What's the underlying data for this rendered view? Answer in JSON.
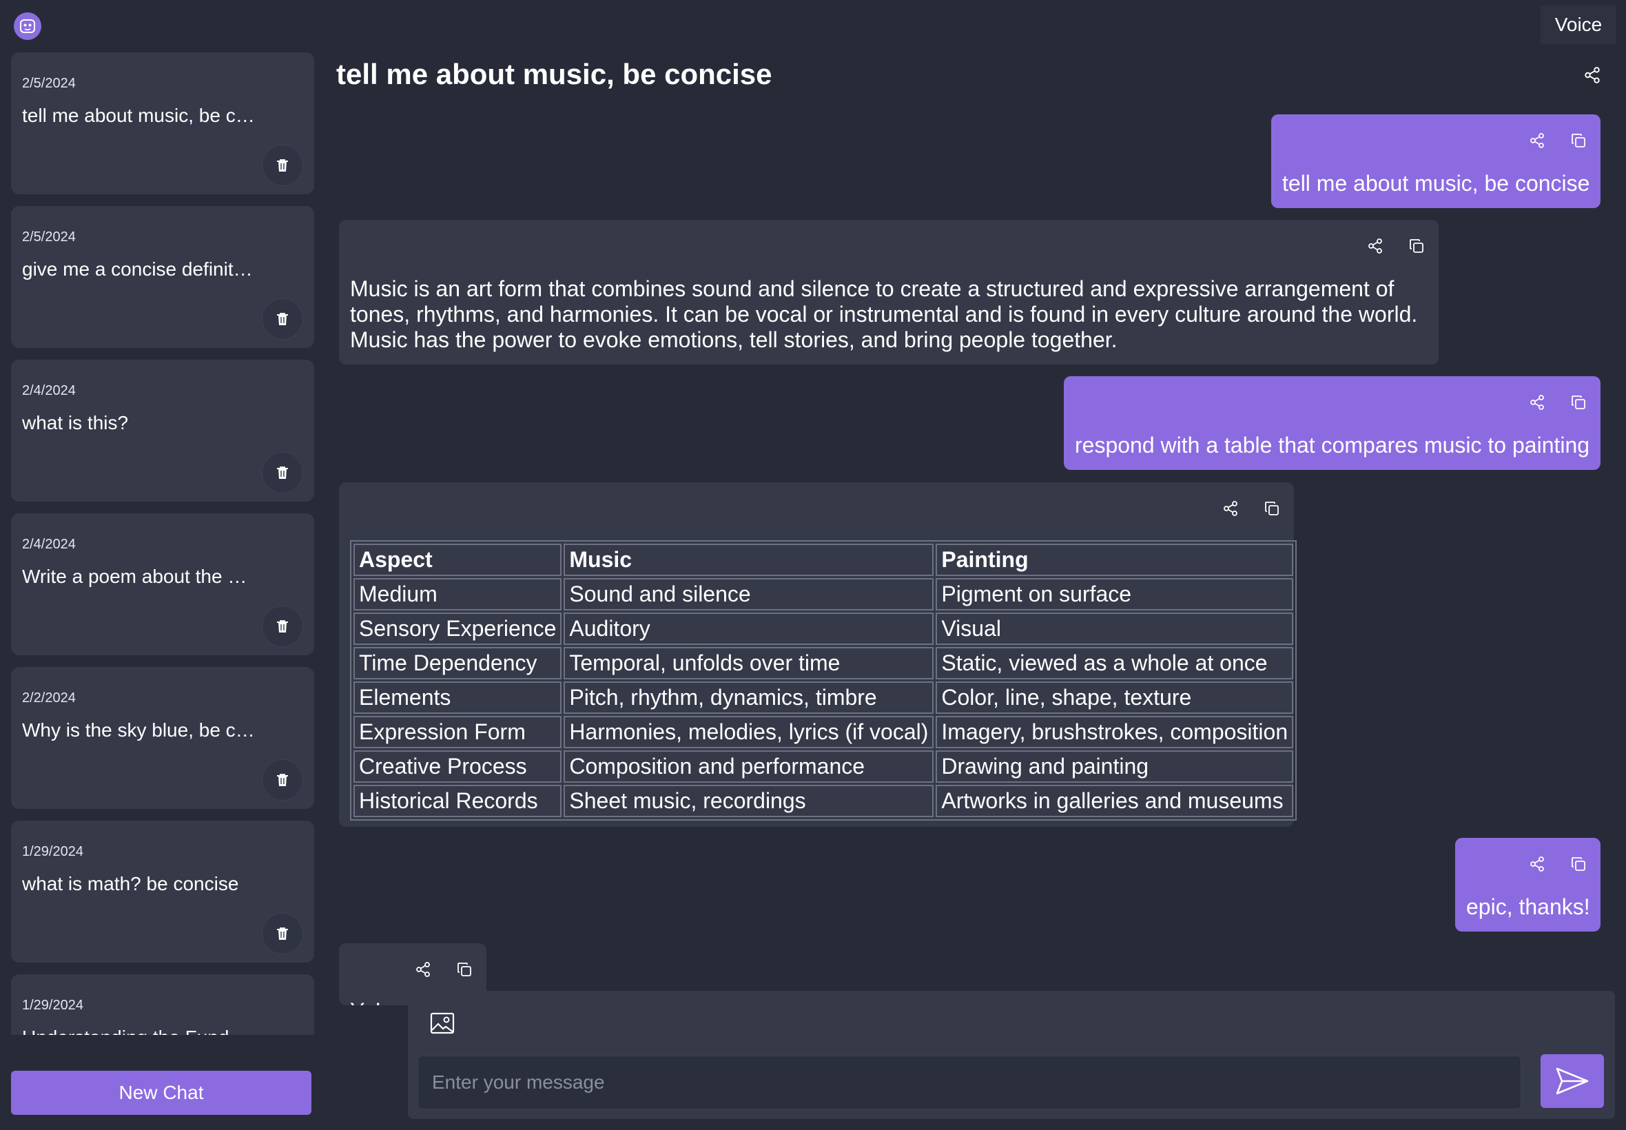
{
  "header": {
    "title": "tell me about music, be concise",
    "voice_label": "Voice"
  },
  "sidebar": {
    "chats": [
      {
        "date": "2/5/2024",
        "title": "tell me about music, be concise"
      },
      {
        "date": "2/5/2024",
        "title": "give me a concise definition"
      },
      {
        "date": "2/4/2024",
        "title": "what is this?"
      },
      {
        "date": "2/4/2024",
        "title": "Write a poem about the sea"
      },
      {
        "date": "2/2/2024",
        "title": "Why is the sky blue, be concise"
      },
      {
        "date": "1/29/2024",
        "title": "what is math? be concise"
      },
      {
        "date": "1/29/2024",
        "title": "Understanding the Fund"
      }
    ],
    "new_chat_label": "New Chat"
  },
  "conversation": {
    "messages": [
      {
        "role": "user",
        "text": "tell me about music, be concise"
      },
      {
        "role": "assistant",
        "text": "Music is an art form that combines sound and silence to create a structured and expressive arrangement of tones, rhythms, and harmonies. It can be vocal or instrumental and is found in every culture around the world. Music has the power to evoke emotions, tell stories, and bring people together."
      },
      {
        "role": "user",
        "text": "respond with a table that compares music to painting"
      },
      {
        "role": "assistant",
        "table": {
          "headers": [
            "Aspect",
            "Music",
            "Painting"
          ],
          "rows": [
            [
              "Medium",
              "Sound and silence",
              "Pigment on surface"
            ],
            [
              "Sensory Experience",
              "Auditory",
              "Visual"
            ],
            [
              "Time Dependency",
              "Temporal, unfolds over time",
              "Static, viewed as a whole at once"
            ],
            [
              "Elements",
              "Pitch, rhythm, dynamics, timbre",
              "Color, line, shape, texture"
            ],
            [
              "Expression Form",
              "Harmonies, melodies, lyrics (if vocal)",
              "Imagery, brushstrokes, composition"
            ],
            [
              "Creative Process",
              "Composition and performance",
              "Drawing and painting"
            ],
            [
              "Historical Records",
              "Sheet music, recordings",
              "Artworks in galleries and museums"
            ]
          ]
        }
      },
      {
        "role": "user",
        "text": "epic, thanks!"
      },
      {
        "role": "assistant",
        "text": "Yo!"
      }
    ]
  },
  "composer": {
    "placeholder": "Enter your message",
    "value": ""
  },
  "icons": {
    "logo": "bot-logo-icon",
    "share": "share-icon",
    "copy": "copy-icon",
    "delete": "trash-icon",
    "image": "image-icon",
    "send": "send-icon"
  },
  "colors": {
    "background": "#272b38",
    "card": "#353948",
    "accent": "#8c6be0"
  }
}
